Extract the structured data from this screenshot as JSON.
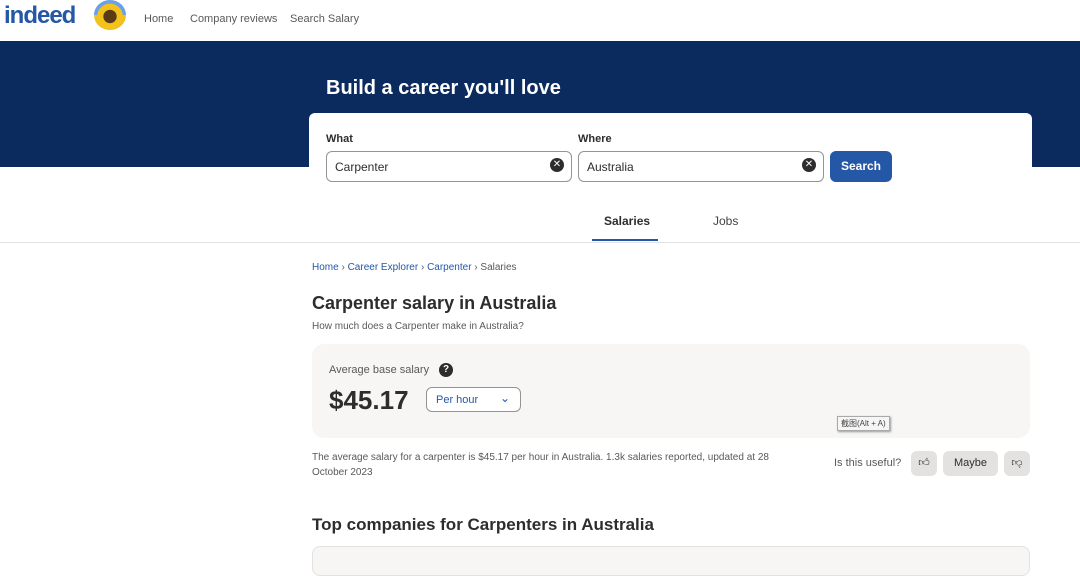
{
  "nav": {
    "logo": "indeed",
    "items": [
      "Home",
      "Company reviews",
      "Search Salary"
    ]
  },
  "hero": {
    "title": "Build a career you'll love"
  },
  "search": {
    "what_label": "What",
    "what_value": "Carpenter",
    "where_label": "Where",
    "where_value": "Australia",
    "button": "Search"
  },
  "tabs": [
    "Salaries",
    "Jobs"
  ],
  "breadcrumb": [
    "Home",
    "Career Explorer",
    "Carpenter",
    "Salaries"
  ],
  "page": {
    "title": "Carpenter salary in Australia",
    "subtitle": "How much does a Carpenter make in Australia?"
  },
  "salary": {
    "label": "Average base salary",
    "help": "?",
    "amount": "$45.17",
    "period": "Per hour"
  },
  "tooltip": "截图(Alt + A)",
  "note": "The average salary for a carpenter is $45.17 per hour in Australia.  1.3k salaries reported, updated at 28 October 2023",
  "feedback": {
    "question": "Is this useful?",
    "maybe": "Maybe"
  },
  "section": {
    "title": "Top companies for Carpenters in Australia"
  },
  "colors": {
    "navy": "#0b2a5e",
    "brand": "#2557a7"
  }
}
